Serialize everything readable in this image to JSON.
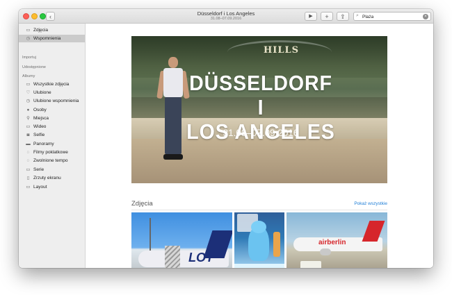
{
  "window": {
    "title": "Düsseldorf i Los Angeles",
    "subtitle": "31.08–07.09.2016"
  },
  "toolbar": {
    "back_icon": "‹",
    "play_icon": "▶",
    "add_icon": "+",
    "share_icon": "⇪",
    "search": {
      "value": "Plaża",
      "icon": "⌕",
      "clear_icon": "×"
    }
  },
  "sidebar": {
    "top_items": [
      {
        "label": "Zdjęcia",
        "icon": "▭"
      },
      {
        "label": "Wspomnienia",
        "icon": "◷"
      }
    ],
    "sections": {
      "imported": "Importuj",
      "shared": "Udostępnione",
      "albums": "Albumy"
    },
    "albums": [
      {
        "label": "Wszystkie zdjęcia",
        "icon": "▭"
      },
      {
        "label": "Ulubione",
        "icon": "♡"
      },
      {
        "label": "Ulubione wspomnienia",
        "icon": "◷"
      },
      {
        "label": "Osoby",
        "icon": "●"
      },
      {
        "label": "Miejsca",
        "icon": "⚲"
      },
      {
        "label": "Wideo",
        "icon": "▭"
      },
      {
        "label": "Selfie",
        "icon": "◙"
      },
      {
        "label": "Panoramy",
        "icon": "▬"
      },
      {
        "label": "Filmy poklatkowe",
        "icon": "◌"
      },
      {
        "label": "Zwolnione tempo",
        "icon": "◌"
      },
      {
        "label": "Serie",
        "icon": "▭"
      },
      {
        "label": "Zrzuty ekranu",
        "icon": "▯"
      },
      {
        "label": "Layout",
        "icon": "▭"
      }
    ]
  },
  "main": {
    "hero": {
      "sign_text": "HILLS",
      "title_line1": "DÜSSELDORF I",
      "title_line2": "LOS ANGELES",
      "dates": "31.08–07.09.2016"
    },
    "photos_section": {
      "title": "Zdjęcia",
      "show_all": "Pokaż wszystkie"
    },
    "thumbs": {
      "plane1_logo": "LOT",
      "plane3_logo": "airberlin"
    }
  },
  "colors": {
    "accent": "#1c7cd6",
    "sidebar_bg": "#eeeeee",
    "selected_bg": "#cbcbcb"
  }
}
